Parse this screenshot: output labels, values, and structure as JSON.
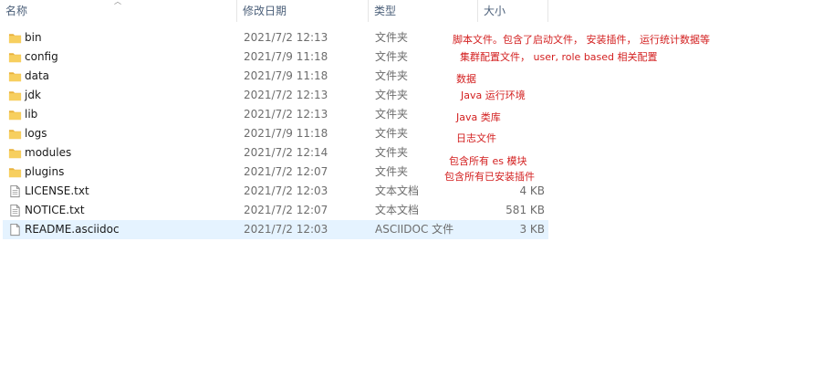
{
  "columns": {
    "name": "名称",
    "modified": "修改日期",
    "type": "类型",
    "size": "大小"
  },
  "files": [
    {
      "name": "bin",
      "modified": "2021/7/2 12:13",
      "type": "文件夹",
      "size": "",
      "icon": "folder-icon"
    },
    {
      "name": "config",
      "modified": "2021/7/9 11:18",
      "type": "文件夹",
      "size": "",
      "icon": "folder-icon"
    },
    {
      "name": "data",
      "modified": "2021/7/9 11:18",
      "type": "文件夹",
      "size": "",
      "icon": "folder-icon"
    },
    {
      "name": "jdk",
      "modified": "2021/7/2 12:13",
      "type": "文件夹",
      "size": "",
      "icon": "folder-icon"
    },
    {
      "name": "lib",
      "modified": "2021/7/2 12:13",
      "type": "文件夹",
      "size": "",
      "icon": "folder-icon"
    },
    {
      "name": "logs",
      "modified": "2021/7/9 11:18",
      "type": "文件夹",
      "size": "",
      "icon": "folder-icon"
    },
    {
      "name": "modules",
      "modified": "2021/7/2 12:14",
      "type": "文件夹",
      "size": "",
      "icon": "folder-icon"
    },
    {
      "name": "plugins",
      "modified": "2021/7/2 12:07",
      "type": "文件夹",
      "size": "",
      "icon": "folder-icon"
    },
    {
      "name": "LICENSE.txt",
      "modified": "2021/7/2 12:03",
      "type": "文本文档",
      "size": "4 KB",
      "icon": "text-file-icon"
    },
    {
      "name": "NOTICE.txt",
      "modified": "2021/7/2 12:07",
      "type": "文本文档",
      "size": "581 KB",
      "icon": "text-file-icon"
    },
    {
      "name": "README.asciidoc",
      "modified": "2021/7/2 12:03",
      "type": "ASCIIDOC 文件",
      "size": "3 KB",
      "icon": "document-file-icon"
    }
  ],
  "annotations": [
    "脚本文件。包含了启动文件， 安装插件， 运行统计数据等",
    "集群配置文件， user, role based 相关配置",
    "数据",
    "Java 运行环境",
    "Java 类库",
    "日志文件",
    "包含所有 es 模块",
    "包含所有已安装插件"
  ],
  "colors": {
    "annotation": "#d32020",
    "selected_row": "#e5f3ff",
    "folder": "#f3c24e",
    "header_text": "#4c607a"
  }
}
